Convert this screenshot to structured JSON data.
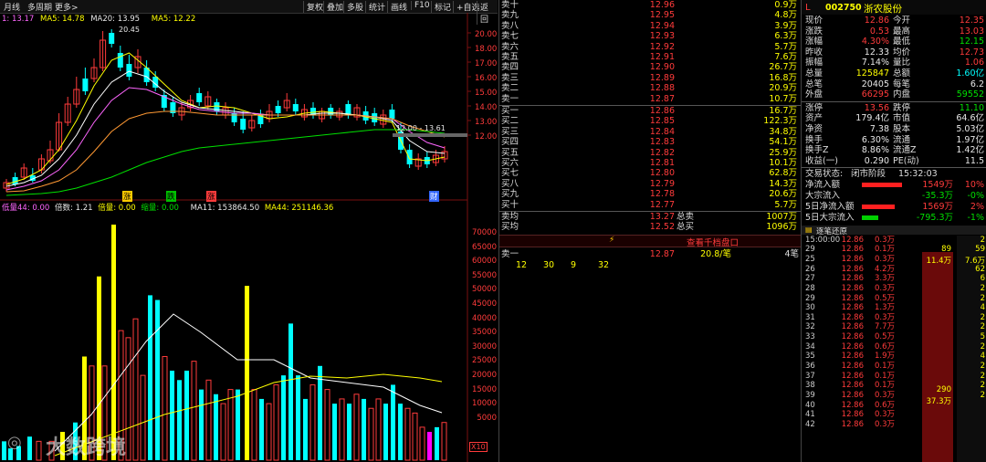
{
  "toolbar": {
    "items": [
      "月线",
      "多周期",
      "更多>"
    ],
    "right_items": [
      "复权",
      "叠加",
      "多股",
      "统计",
      "画线",
      "F10",
      "标记",
      "+自选",
      "返回"
    ]
  },
  "ma_legend": {
    "ma_prefix": "1: 13.17",
    "ma5_label": "MA5: 14.78",
    "ma20_label": "MA20: 13.95",
    "ma5b_label": "MA5: 12.22"
  },
  "price_axis": [
    "20.00",
    "18.00",
    "17.00",
    "16.00",
    "15.00",
    "14.00",
    "13.00",
    "12.00"
  ],
  "chart_annotations": {
    "high_label": "20.45",
    "range_label": "12.00 - 13.61",
    "mark_up": "涨",
    "mark_down1": "跌",
    "mark_down2": "涨",
    "mark_fin": "财"
  },
  "volume_legend": {
    "low_label": "低量44: 0.00",
    "multi_label": "倍数: 1.21",
    "vol_label": "倍量: 0.00",
    "shrink_label": "缩量: 0.00",
    "ma11_label": "MA11: 153864.50",
    "ma44_label": "MA44: 251146.36"
  },
  "volume_axis": [
    "70000",
    "65000",
    "60000",
    "55000",
    "50000",
    "45000",
    "40000",
    "35000",
    "30000",
    "25000",
    "20000",
    "15000",
    "10000",
    "5000"
  ],
  "volume_unit": "X10",
  "watermark": "大数跨境",
  "order_book": {
    "asks": [
      {
        "label": "卖十",
        "price": "12.96",
        "vol": "0.9万"
      },
      {
        "label": "卖九",
        "price": "12.95",
        "vol": "4.8万"
      },
      {
        "label": "卖八",
        "price": "12.94",
        "vol": "3.9万"
      },
      {
        "label": "卖七",
        "price": "12.93",
        "vol": "6.3万"
      },
      {
        "label": "卖六",
        "price": "12.92",
        "vol": "5.7万"
      },
      {
        "label": "卖五",
        "price": "12.91",
        "vol": "7.6万"
      },
      {
        "label": "卖四",
        "price": "12.90",
        "vol": "26.7万"
      },
      {
        "label": "卖三",
        "price": "12.89",
        "vol": "16.8万"
      },
      {
        "label": "卖二",
        "price": "12.88",
        "vol": "20.9万"
      },
      {
        "label": "卖一",
        "price": "12.87",
        "vol": "10.7万"
      }
    ],
    "bids": [
      {
        "label": "买一",
        "price": "12.86",
        "vol": "16.7万"
      },
      {
        "label": "买二",
        "price": "12.85",
        "vol": "122.3万"
      },
      {
        "label": "买三",
        "price": "12.84",
        "vol": "34.8万"
      },
      {
        "label": "买四",
        "price": "12.83",
        "vol": "54.1万"
      },
      {
        "label": "买五",
        "price": "12.82",
        "vol": "25.9万"
      },
      {
        "label": "买六",
        "price": "12.81",
        "vol": "10.1万"
      },
      {
        "label": "买七",
        "price": "12.80",
        "vol": "62.8万"
      },
      {
        "label": "买八",
        "price": "12.79",
        "vol": "14.3万"
      },
      {
        "label": "买九",
        "price": "12.78",
        "vol": "20.6万"
      },
      {
        "label": "买十",
        "price": "12.77",
        "vol": "5.7万"
      }
    ],
    "avg_ask": {
      "label": "卖均",
      "price": "13.27",
      "tag": "总卖",
      "vol": "1007万"
    },
    "avg_bid": {
      "label": "买均",
      "price": "12.52",
      "tag": "总买",
      "vol": "1096万"
    },
    "queue_title": "查看千档盘口",
    "queue_row": {
      "label": "卖一",
      "price": "12.87",
      "vol": "20.8/笔",
      "count": "4笔"
    },
    "queue_values": [
      "12",
      "30",
      "9",
      "32"
    ]
  },
  "stock": {
    "code": "002750",
    "name": "浙农股份",
    "flag": "L"
  },
  "quote": [
    {
      "l1": "现价",
      "v1": "12.86",
      "c1": "red",
      "l2": "今开",
      "v2": "12.35",
      "c2": "red"
    },
    {
      "l1": "涨跌",
      "v1": "0.53",
      "c1": "red",
      "l2": "最高",
      "v2": "13.03",
      "c2": "red"
    },
    {
      "l1": "涨幅",
      "v1": "4.30%",
      "c1": "red",
      "l2": "最低",
      "v2": "12.15",
      "c2": "green"
    },
    {
      "l1": "昨收",
      "v1": "12.33",
      "c1": "white",
      "l2": "均价",
      "v2": "12.73",
      "c2": "red"
    },
    {
      "l1": "振幅",
      "v1": "7.14%",
      "c1": "white",
      "l2": "量比",
      "v2": "1.06",
      "c2": "red"
    },
    {
      "l1": "总量",
      "v1": "125847",
      "c1": "yellow",
      "l2": "总额",
      "v2": "1.60亿",
      "c2": "cyan"
    },
    {
      "l1": "总笔",
      "v1": "20405",
      "c1": "white",
      "l2": "每笔",
      "v2": "6.2",
      "c2": "white"
    },
    {
      "l1": "外盘",
      "v1": "66295",
      "c1": "red",
      "l2": "内盘",
      "v2": "59552",
      "c2": "green"
    }
  ],
  "quote2": [
    {
      "l1": "涨停",
      "v1": "13.56",
      "c1": "red",
      "l2": "跌停",
      "v2": "11.10",
      "c2": "green"
    },
    {
      "l1": "资产",
      "v1": "179.4亿",
      "c1": "white",
      "l2": "市值",
      "v2": "64.6亿",
      "c2": "white"
    },
    {
      "l1": "净资",
      "v1": "7.38",
      "c1": "white",
      "l2": "股本",
      "v2": "5.03亿",
      "c2": "white"
    },
    {
      "l1": "换手",
      "v1": "6.30%",
      "c1": "white",
      "l2": "流通",
      "v2": "1.97亿",
      "c2": "white"
    },
    {
      "l1": "换手Z",
      "v1": "8.86%",
      "c1": "white",
      "l2": "流通Z",
      "v2": "1.42亿",
      "c2": "white"
    },
    {
      "l1": "收益(一)",
      "v1": "0.290",
      "c1": "white",
      "l2": "PE(动)",
      "v2": "11.5",
      "c2": "white"
    }
  ],
  "trade_status": {
    "label": "交易状态:",
    "status": "闭市阶段",
    "time": "15:32:03"
  },
  "flows": [
    {
      "label": "净流入额",
      "value": "1549万",
      "pct": "10%",
      "color": "red",
      "bar": 0.85
    },
    {
      "label": "大宗流入",
      "value": "-35.3万",
      "pct": "-0%",
      "color": "green",
      "bar": 0.0
    },
    {
      "label": "5日净流入额",
      "value": "1569万",
      "pct": "2%",
      "color": "red",
      "bar": 0.7
    },
    {
      "label": "5日大宗流入",
      "value": "-795.3万",
      "pct": "-1%",
      "color": "green",
      "bar": 0.35
    }
  ],
  "ticks_title": "逐笔还原",
  "ticks": [
    {
      "t": "15:00:00",
      "p": "12.86",
      "v": "0.3万"
    },
    {
      "t": "29",
      "p": "12.86",
      "v": "0.1万"
    },
    {
      "t": "25",
      "p": "12.86",
      "v": "0.3万"
    },
    {
      "t": "26",
      "p": "12.86",
      "v": "4.2万"
    },
    {
      "t": "27",
      "p": "12.86",
      "v": "3.3万"
    },
    {
      "t": "28",
      "p": "12.86",
      "v": "0.3万"
    },
    {
      "t": "29",
      "p": "12.86",
      "v": "0.5万"
    },
    {
      "t": "30",
      "p": "12.86",
      "v": "1.3万"
    },
    {
      "t": "31",
      "p": "12.86",
      "v": "0.3万"
    },
    {
      "t": "32",
      "p": "12.86",
      "v": "7.7万"
    },
    {
      "t": "33",
      "p": "12.86",
      "v": "0.5万"
    },
    {
      "t": "34",
      "p": "12.86",
      "v": "0.6万"
    },
    {
      "t": "35",
      "p": "12.86",
      "v": "1.9万"
    },
    {
      "t": "36",
      "p": "12.86",
      "v": "0.1万"
    },
    {
      "t": "37",
      "p": "12.86",
      "v": "0.1万"
    },
    {
      "t": "38",
      "p": "12.86",
      "v": "0.1万"
    },
    {
      "t": "39",
      "p": "12.86",
      "v": "0.3万"
    },
    {
      "t": "40",
      "p": "12.86",
      "v": "0.6万"
    },
    {
      "t": "41",
      "p": "12.86",
      "v": "0.3万"
    },
    {
      "t": "42",
      "p": "12.86",
      "v": "0.3万"
    }
  ],
  "tick_side": {
    "n1": "89",
    "v1": "11.4万",
    "n2": "290",
    "v2": "37.3万"
  },
  "tick_far": [
    "2",
    "59",
    "7.6万",
    "62",
    "6",
    "2",
    "2",
    "4",
    "2",
    "2",
    "5",
    "2",
    "4",
    "2",
    "2",
    "2",
    "2"
  ]
}
